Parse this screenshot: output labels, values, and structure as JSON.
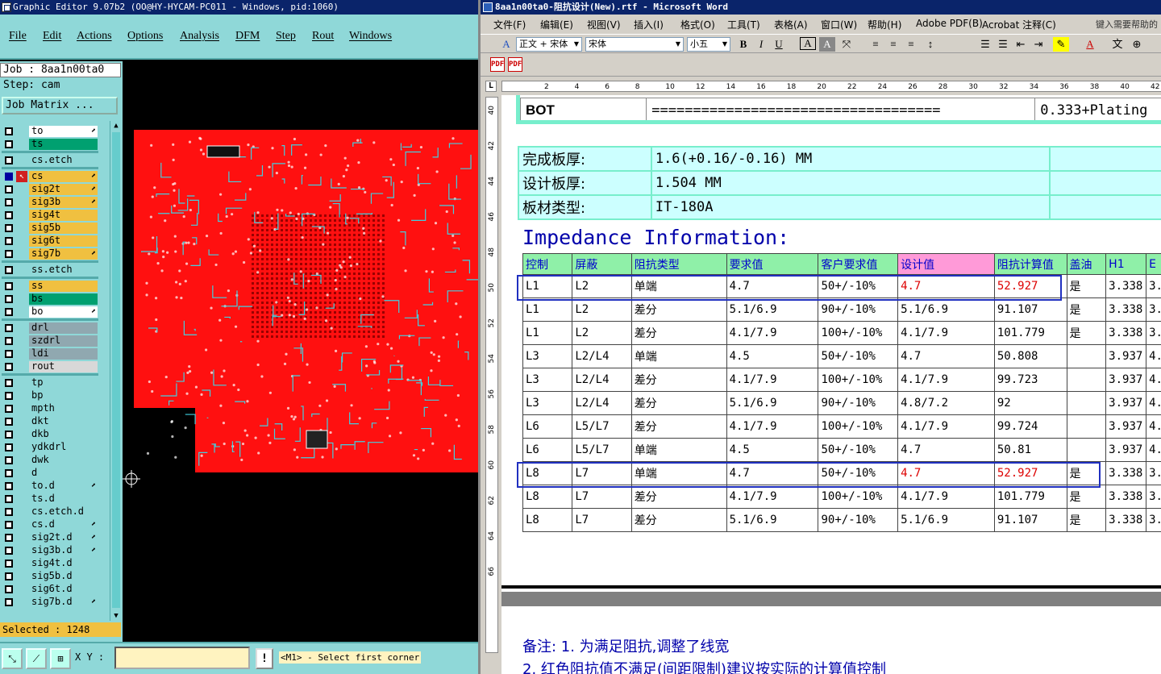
{
  "genesis": {
    "title": "Graphic Editor 9.07b2 (OO@HY-HYCAM-PC011 - Windows, pid:1060)",
    "menu": [
      "File",
      "Edit",
      "Actions",
      "Options",
      "Analysis",
      "DFM",
      "Step",
      "Rout",
      "Windows"
    ],
    "job": "Job : 8aa1n00ta0",
    "step": "Step: cam",
    "job_matrix_label": "Job Matrix ...",
    "layers": [
      {
        "name": "to",
        "color": "#ffffff",
        "tick": true,
        "checked": false
      },
      {
        "name": "ts",
        "color": "#00a070",
        "tick": false,
        "checked": false
      },
      {
        "name": "cs.etch",
        "color": "#8fd8d8",
        "tick": false,
        "checked": false,
        "sep_before": true
      },
      {
        "name": "cs",
        "color": "#f0c040",
        "tick": true,
        "checked": true,
        "sep_before": true
      },
      {
        "name": "sig2t",
        "color": "#f0c040",
        "tick": true,
        "checked": false
      },
      {
        "name": "sig3b",
        "color": "#f0c040",
        "tick": true,
        "checked": false
      },
      {
        "name": "sig4t",
        "color": "#f0c040",
        "tick": false,
        "checked": false
      },
      {
        "name": "sig5b",
        "color": "#f0c040",
        "tick": false,
        "checked": false
      },
      {
        "name": "sig6t",
        "color": "#f0c040",
        "tick": false,
        "checked": false
      },
      {
        "name": "sig7b",
        "color": "#f0c040",
        "tick": true,
        "checked": false
      },
      {
        "name": "ss.etch",
        "color": "#8fd8d8",
        "tick": false,
        "checked": false,
        "sep_before": true
      },
      {
        "name": "ss",
        "color": "#f0c040",
        "tick": false,
        "checked": false,
        "sep_before": true
      },
      {
        "name": "bs",
        "color": "#00a070",
        "tick": false,
        "checked": false
      },
      {
        "name": "bo",
        "color": "#ffffff",
        "tick": true,
        "checked": false
      },
      {
        "name": "drl",
        "color": "#90a8b0",
        "tick": false,
        "checked": false,
        "sep_before": true
      },
      {
        "name": "szdrl",
        "color": "#90a8b0",
        "tick": false,
        "checked": false
      },
      {
        "name": "ldi",
        "color": "#90a8b0",
        "tick": false,
        "checked": false
      },
      {
        "name": "rout",
        "color": "#d8d8d8",
        "tick": false,
        "checked": false
      },
      {
        "name": "tp",
        "color": "#8fd8d8",
        "tick": false,
        "checked": false,
        "sep_before": true
      },
      {
        "name": "bp",
        "color": "#8fd8d8",
        "tick": false,
        "checked": false
      },
      {
        "name": "mpth",
        "color": "#8fd8d8",
        "tick": false,
        "checked": false
      },
      {
        "name": "dkt",
        "color": "#8fd8d8",
        "tick": false,
        "checked": false
      },
      {
        "name": "dkb",
        "color": "#8fd8d8",
        "tick": false,
        "checked": false
      },
      {
        "name": "ydkdrl",
        "color": "#8fd8d8",
        "tick": false,
        "checked": false
      },
      {
        "name": "dwk",
        "color": "#8fd8d8",
        "tick": false,
        "checked": false
      },
      {
        "name": "d",
        "color": "#8fd8d8",
        "tick": false,
        "checked": false
      },
      {
        "name": "to.d",
        "color": "#8fd8d8",
        "tick": true,
        "checked": false
      },
      {
        "name": "ts.d",
        "color": "#8fd8d8",
        "tick": false,
        "checked": false
      },
      {
        "name": "cs.etch.d",
        "color": "#8fd8d8",
        "tick": false,
        "checked": false
      },
      {
        "name": "cs.d",
        "color": "#8fd8d8",
        "tick": true,
        "checked": false
      },
      {
        "name": "sig2t.d",
        "color": "#8fd8d8",
        "tick": true,
        "checked": false
      },
      {
        "name": "sig3b.d",
        "color": "#8fd8d8",
        "tick": true,
        "checked": false
      },
      {
        "name": "sig4t.d",
        "color": "#8fd8d8",
        "tick": false,
        "checked": false
      },
      {
        "name": "sig5b.d",
        "color": "#8fd8d8",
        "tick": false,
        "checked": false
      },
      {
        "name": "sig6t.d",
        "color": "#8fd8d8",
        "tick": false,
        "checked": false
      },
      {
        "name": "sig7b.d",
        "color": "#8fd8d8",
        "tick": true,
        "checked": false
      }
    ],
    "selected": "Selected : 1248",
    "xy_label": "X Y :",
    "xy_value": "",
    "prompt_icon": "!",
    "prompt": "<M1> - Select first corner",
    "board_color": "#ff1010",
    "trace_color": "#40d0e0"
  },
  "word": {
    "title": "8aa1n00ta0-阻抗设计(New).rtf - Microsoft Word",
    "menu": [
      "文件(F)",
      "编辑(E)",
      "视图(V)",
      "插入(I)",
      "格式(O)",
      "工具(T)",
      "表格(A)",
      "窗口(W)",
      "帮助(H)",
      "Adobe PDF(B)",
      "Acrobat 注释(C)"
    ],
    "help_placeholder": "键入需要帮助的",
    "style_combo": "正文 + 宋体",
    "font_combo": "宋体",
    "size_combo": "小五",
    "fmt_buttons": [
      "B",
      "I",
      "U",
      "A",
      "A"
    ],
    "ruler_numbers": [
      "2",
      "4",
      "6",
      "8",
      "10",
      "12",
      "14",
      "16",
      "18",
      "20",
      "22",
      "24",
      "26",
      "28",
      "30",
      "32",
      "34",
      "36",
      "38",
      "40",
      "42"
    ],
    "vruler_numbers": [
      "40",
      "42",
      "44",
      "46",
      "48",
      "50",
      "52",
      "54",
      "56",
      "58",
      "60",
      "62",
      "64",
      "66"
    ],
    "bot_row": {
      "label": "BOT",
      "line": "===================================",
      "value": "0.333+Plating"
    },
    "thickness_rows": [
      {
        "label": "完成板厚:",
        "value": "1.6(+0.16/-0.16) MM"
      },
      {
        "label": "设计板厚:",
        "value": "1.504 MM"
      },
      {
        "label": "板材类型:",
        "value": "IT-180A"
      }
    ],
    "impedance_title": "Impedance Information:",
    "impedance_headers": [
      "控制",
      "屏蔽",
      "阻抗类型",
      "要求值",
      "客户要求值",
      "设计值",
      "阻抗计算值",
      "盖油",
      "H1",
      "E"
    ],
    "impedance_rows": [
      [
        "L1",
        "L2",
        "单端",
        "4.7",
        "50+/-10%",
        "4.7",
        "52.927",
        "是",
        "3.338",
        "3."
      ],
      [
        "L1",
        "L2",
        "差分",
        "5.1/6.9",
        "90+/-10%",
        "5.1/6.9",
        "91.107",
        "是",
        "3.338",
        "3."
      ],
      [
        "L1",
        "L2",
        "差分",
        "4.1/7.9",
        "100+/-10%",
        "4.1/7.9",
        "101.779",
        "是",
        "3.338",
        "3."
      ],
      [
        "L3",
        "L2/L4",
        "单端",
        "4.5",
        "50+/-10%",
        "4.7",
        "50.808",
        "",
        "3.937",
        "4."
      ],
      [
        "L3",
        "L2/L4",
        "差分",
        "4.1/7.9",
        "100+/-10%",
        "4.1/7.9",
        "99.723",
        "",
        "3.937",
        "4."
      ],
      [
        "L3",
        "L2/L4",
        "差分",
        "5.1/6.9",
        "90+/-10%",
        "4.8/7.2",
        "92",
        "",
        "3.937",
        "4."
      ],
      [
        "L6",
        "L5/L7",
        "差分",
        "4.1/7.9",
        "100+/-10%",
        "4.1/7.9",
        "99.724",
        "",
        "3.937",
        "4."
      ],
      [
        "L6",
        "L5/L7",
        "单端",
        "4.5",
        "50+/-10%",
        "4.7",
        "50.81",
        "",
        "3.937",
        "4."
      ],
      [
        "L8",
        "L7",
        "单端",
        "4.7",
        "50+/-10%",
        "4.7",
        "52.927",
        "是",
        "3.338",
        "3."
      ],
      [
        "L8",
        "L7",
        "差分",
        "4.1/7.9",
        "100+/-10%",
        "4.1/7.9",
        "101.779",
        "是",
        "3.338",
        "3."
      ],
      [
        "L8",
        "L7",
        "差分",
        "5.1/6.9",
        "90+/-10%",
        "5.1/6.9",
        "91.107",
        "是",
        "3.338",
        "3."
      ]
    ],
    "red_rows": [
      0,
      8
    ],
    "note1": "备注: 1. 为满足阻抗,调整了线宽",
    "note2": "2. 红色阻抗值不满足(间距限制)建议按实际的计算值控制"
  }
}
